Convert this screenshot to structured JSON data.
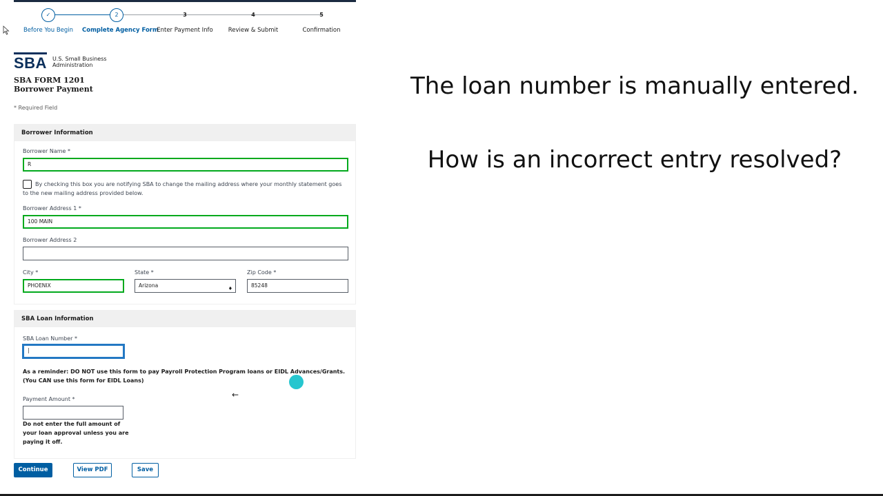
{
  "stepper": {
    "steps": [
      {
        "number": "✓",
        "label": "Before You Begin",
        "state": "done"
      },
      {
        "number": "2",
        "label": "Complete Agency Form",
        "state": "current"
      },
      {
        "number": "3",
        "label": "Enter Payment Info",
        "state": "upcoming"
      },
      {
        "number": "4",
        "label": "Review & Submit",
        "state": "upcoming"
      },
      {
        "number": "5",
        "label": "Confirmation",
        "state": "upcoming"
      }
    ]
  },
  "header": {
    "logo_mark": "SBA",
    "logo_line1": "U.S. Small Business",
    "logo_line2": "Administration",
    "form_number": "SBA FORM 1201",
    "form_name": "Borrower Payment",
    "required_note": "* Required Field"
  },
  "borrower_section": {
    "title": "Borrower Information",
    "name_label": "Borrower Name *",
    "name_value": "R",
    "mailing_checkbox_label": "By checking this box you are notifying SBA to change the mailing address where your monthly statement goes to the new mailing address provided below.",
    "mailing_checkbox_checked": false,
    "address1_label": "Borrower Address 1 *",
    "address1_value": "100 MAIN",
    "address2_label": "Borrower Address 2",
    "address2_value": "",
    "city_label": "City *",
    "city_value": "PHOENIX",
    "state_label": "State *",
    "state_value": "Arizona",
    "zip_label": "Zip Code *",
    "zip_value": "85248"
  },
  "loan_section": {
    "title": "SBA Loan Information",
    "loan_number_label": "SBA Loan Number *",
    "loan_number_value": "|",
    "reminder": "As a reminder: DO NOT use this form to pay Payroll Protection Program loans or EIDL Advances/Grants. (You CAN use this form for EIDL Loans)",
    "amount_label": "Payment Amount *",
    "amount_value": "",
    "amount_note": "Do not enter the full amount of your loan approval unless you are paying it off."
  },
  "buttons": {
    "continue": "Continue",
    "view_pdf": "View PDF",
    "save": "Save"
  },
  "overlay": {
    "line1": "The loan number is manually entered.",
    "line2": "How is an incorrect entry resolved?",
    "arrow": "←"
  },
  "colors": {
    "primary": "#005ea2",
    "valid": "#00a91c",
    "focus": "#2378c3",
    "highlight_dot": "#26c6cf"
  }
}
